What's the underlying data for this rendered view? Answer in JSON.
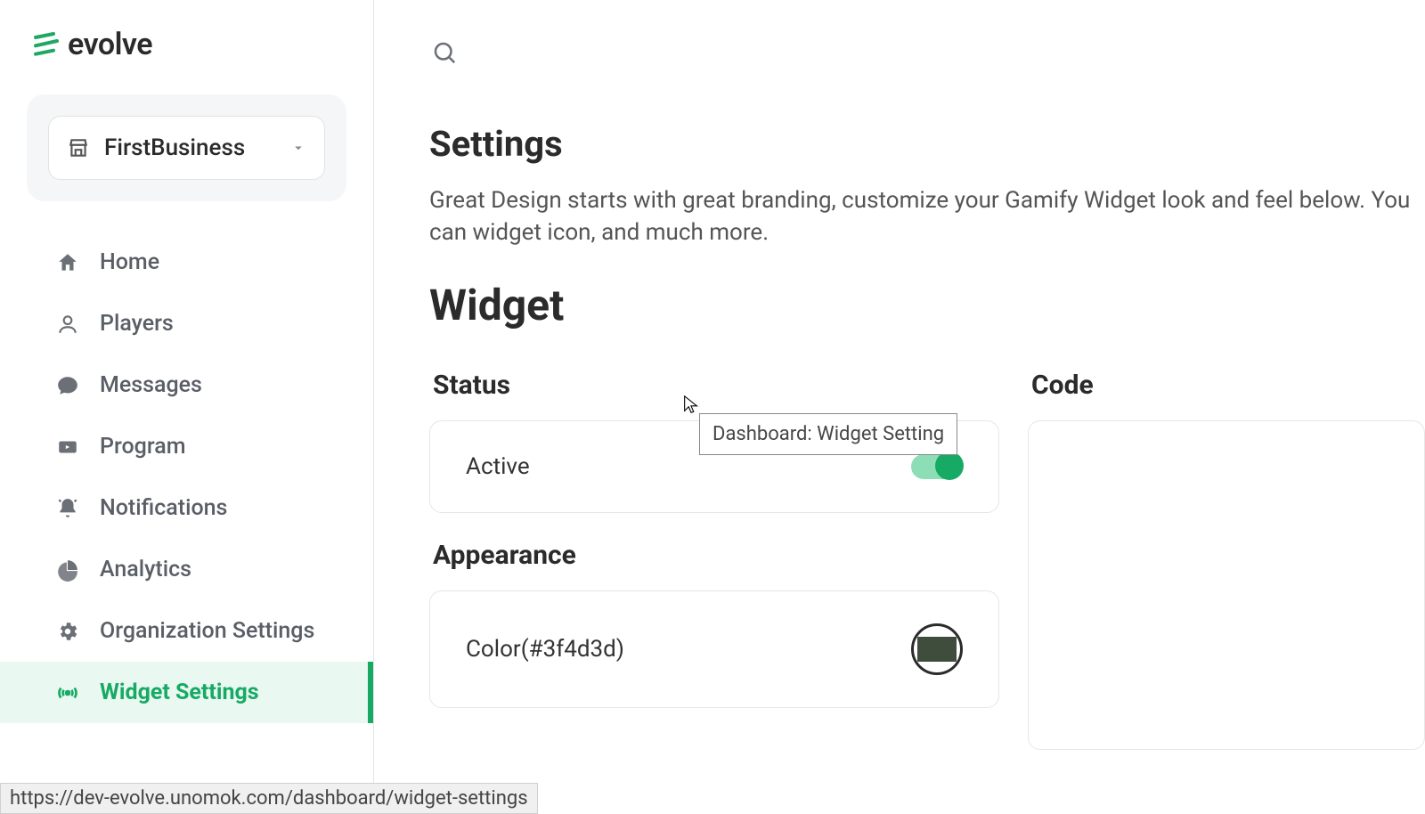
{
  "brand": {
    "name": "evolve"
  },
  "business": {
    "selected": "FirstBusiness"
  },
  "sidebar": {
    "items": [
      {
        "label": "Home"
      },
      {
        "label": "Players"
      },
      {
        "label": "Messages"
      },
      {
        "label": "Program"
      },
      {
        "label": "Notifications"
      },
      {
        "label": "Analytics"
      },
      {
        "label": "Organization Settings"
      },
      {
        "label": "Widget Settings"
      }
    ]
  },
  "page": {
    "title": "Settings",
    "description": "Great Design starts with great branding, customize your Gamify Widget look and feel below. You can widget icon, and much more.",
    "widget_heading": "Widget"
  },
  "status": {
    "section_label": "Status",
    "active_label": "Active",
    "active": true
  },
  "appearance": {
    "section_label": "Appearance",
    "color_label": "Color(#3f4d3d)",
    "color_value": "#3f4d3d"
  },
  "code": {
    "section_label": "Code"
  },
  "tooltip": {
    "text": "Dashboard: Widget Setting"
  },
  "statusbar": {
    "url": "https://dev-evolve.unomok.com/dashboard/widget-settings"
  }
}
